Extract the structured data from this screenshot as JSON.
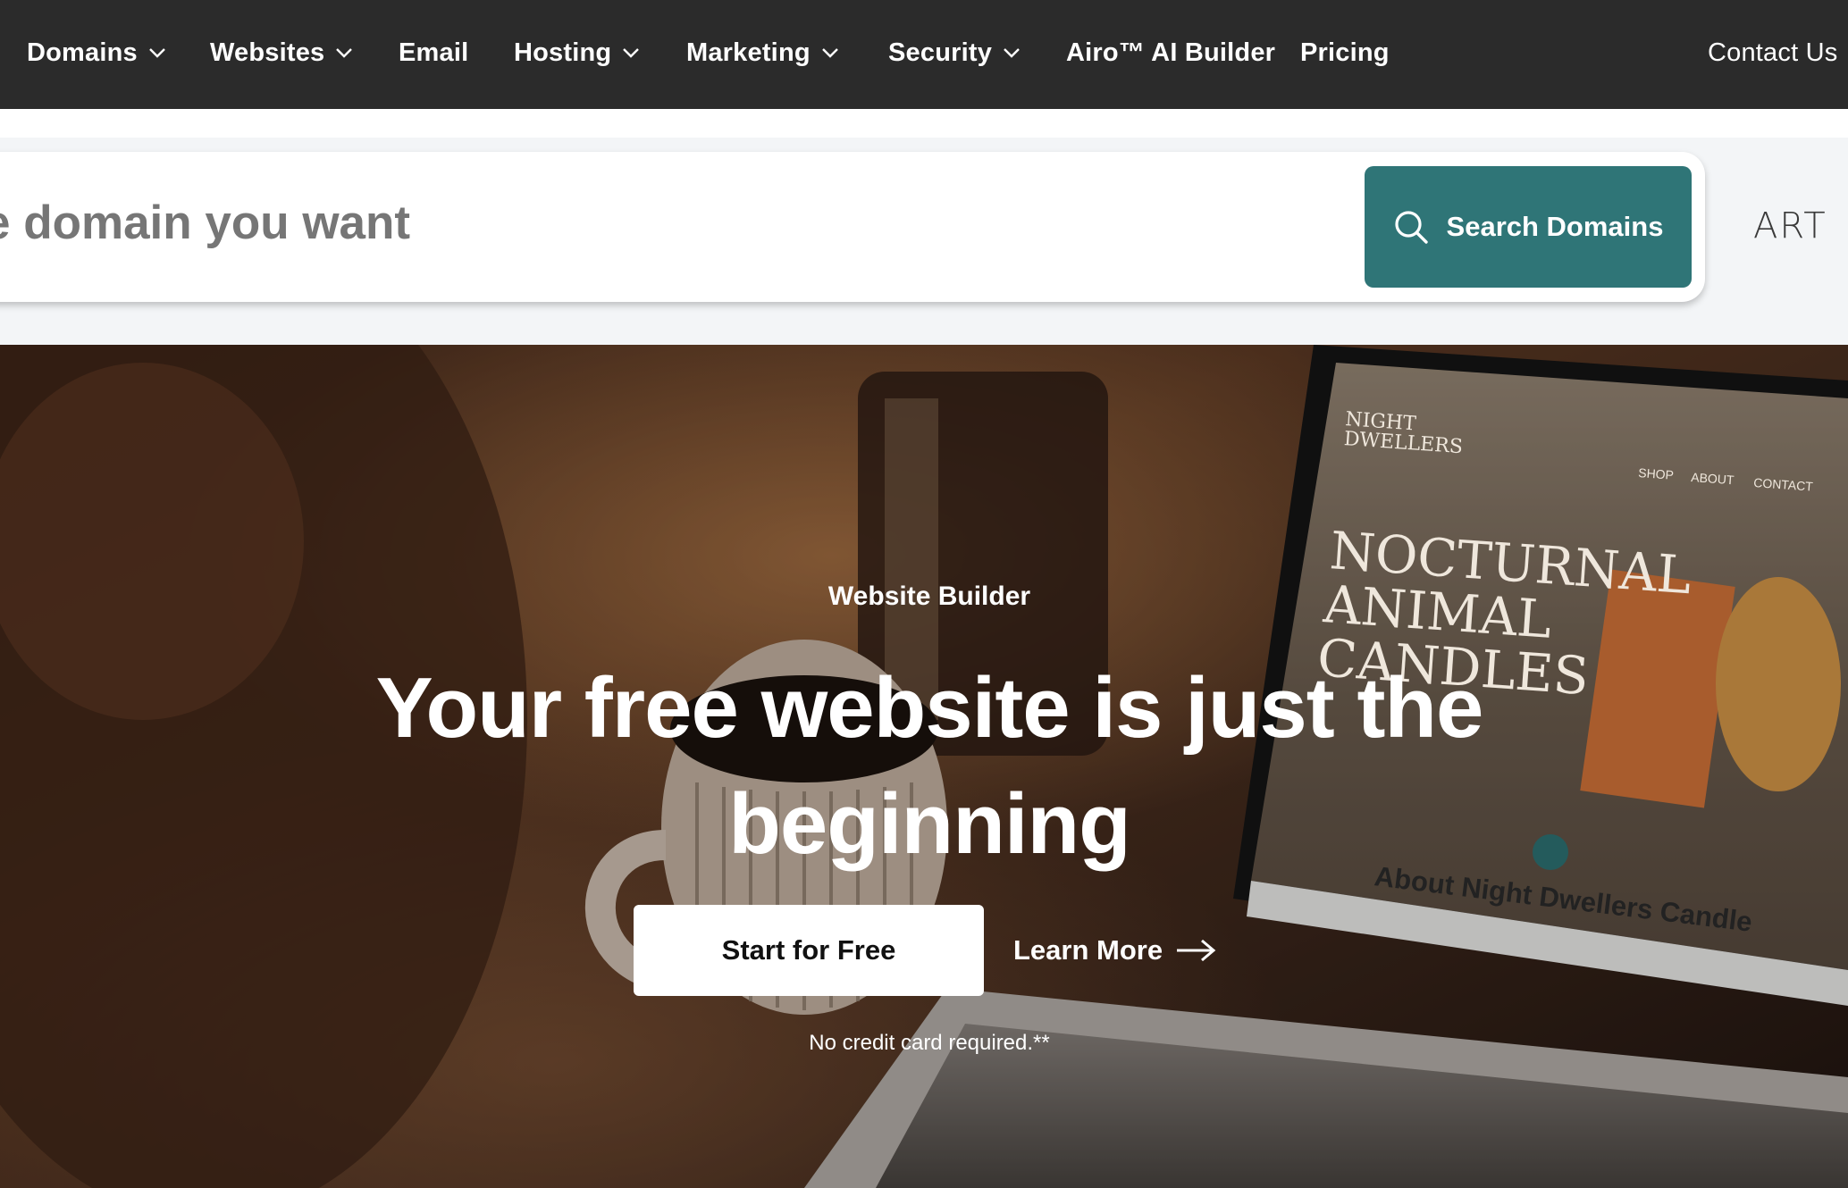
{
  "nav": {
    "items": [
      {
        "label": "Domains",
        "has_dropdown": true
      },
      {
        "label": "Websites",
        "has_dropdown": true
      },
      {
        "label": "Email",
        "has_dropdown": false
      },
      {
        "label": "Hosting",
        "has_dropdown": true
      },
      {
        "label": "Marketing",
        "has_dropdown": true
      },
      {
        "label": "Security",
        "has_dropdown": true
      },
      {
        "label": "Airo™ AI Builder",
        "has_dropdown": false
      },
      {
        "label": "Pricing",
        "has_dropdown": false
      }
    ],
    "contact_label": "Contact Us"
  },
  "search": {
    "placeholder": "e domain you want",
    "button_label": "Search Domains",
    "side_logo_text": "ART"
  },
  "hero": {
    "eyebrow": "Website Builder",
    "title": "Your free website is just the beginning",
    "primary_cta": "Start for Free",
    "secondary_cta": "Learn More",
    "note": "No credit card required.**",
    "laptop_screen": {
      "brand": "NIGHT DWELLERS",
      "menu": [
        "SHOP",
        "ABOUT",
        "CONTACT"
      ],
      "headline_lines": [
        "NOCTURNAL",
        "ANIMAL",
        "CANDLES"
      ],
      "section_heading": "About Night Dwellers Candle"
    }
  },
  "colors": {
    "nav_bg": "#2b2b2b",
    "search_button": "#2f7577",
    "search_band_bg": "#f3f5f7",
    "placeholder_text": "#767676"
  }
}
